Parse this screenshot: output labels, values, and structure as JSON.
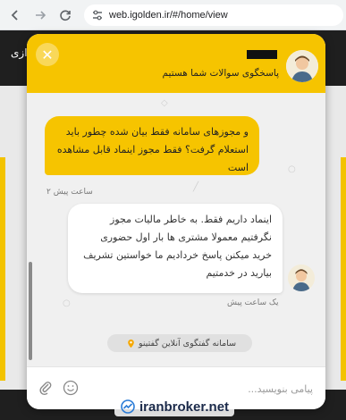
{
  "browser": {
    "url": "web.igolden.ir/#/home/view"
  },
  "page": {
    "nav_text": "ازی"
  },
  "chat": {
    "header": {
      "subtitle": "پاسخگوی سوالات شما هستیم"
    },
    "messages": [
      {
        "from": "user",
        "text": "و مجوزهای سامانه فقط بیان شده چطور باید استعلام گرفت؟ فقط مجوز اینماد قابل مشاهده است",
        "time": "۲ ساعت پیش"
      },
      {
        "from": "agent",
        "text": "اینماد داریم فقط. به خاطر مالیات مجوز نگرفتیم معمولا مشتری ها بار اول حضوری خرید میکنن پاسخ خردادیم ما خواستین تشریف بیارید در خدمتیم",
        "time": "یک ساعت پیش"
      }
    ],
    "badge": "سامانه گفتگوی آنلاین گفتینو",
    "composer": {
      "placeholder": "پیامی بنویسید..."
    }
  },
  "watermark": "iranbroker.net",
  "colors": {
    "accent": "#f6c400",
    "header_text": "#222222"
  },
  "icons": [
    "back-icon",
    "forward-icon",
    "reload-icon",
    "site-info-icon",
    "close-icon",
    "avatar",
    "location-pin-icon",
    "attach-icon",
    "emoji-icon"
  ]
}
